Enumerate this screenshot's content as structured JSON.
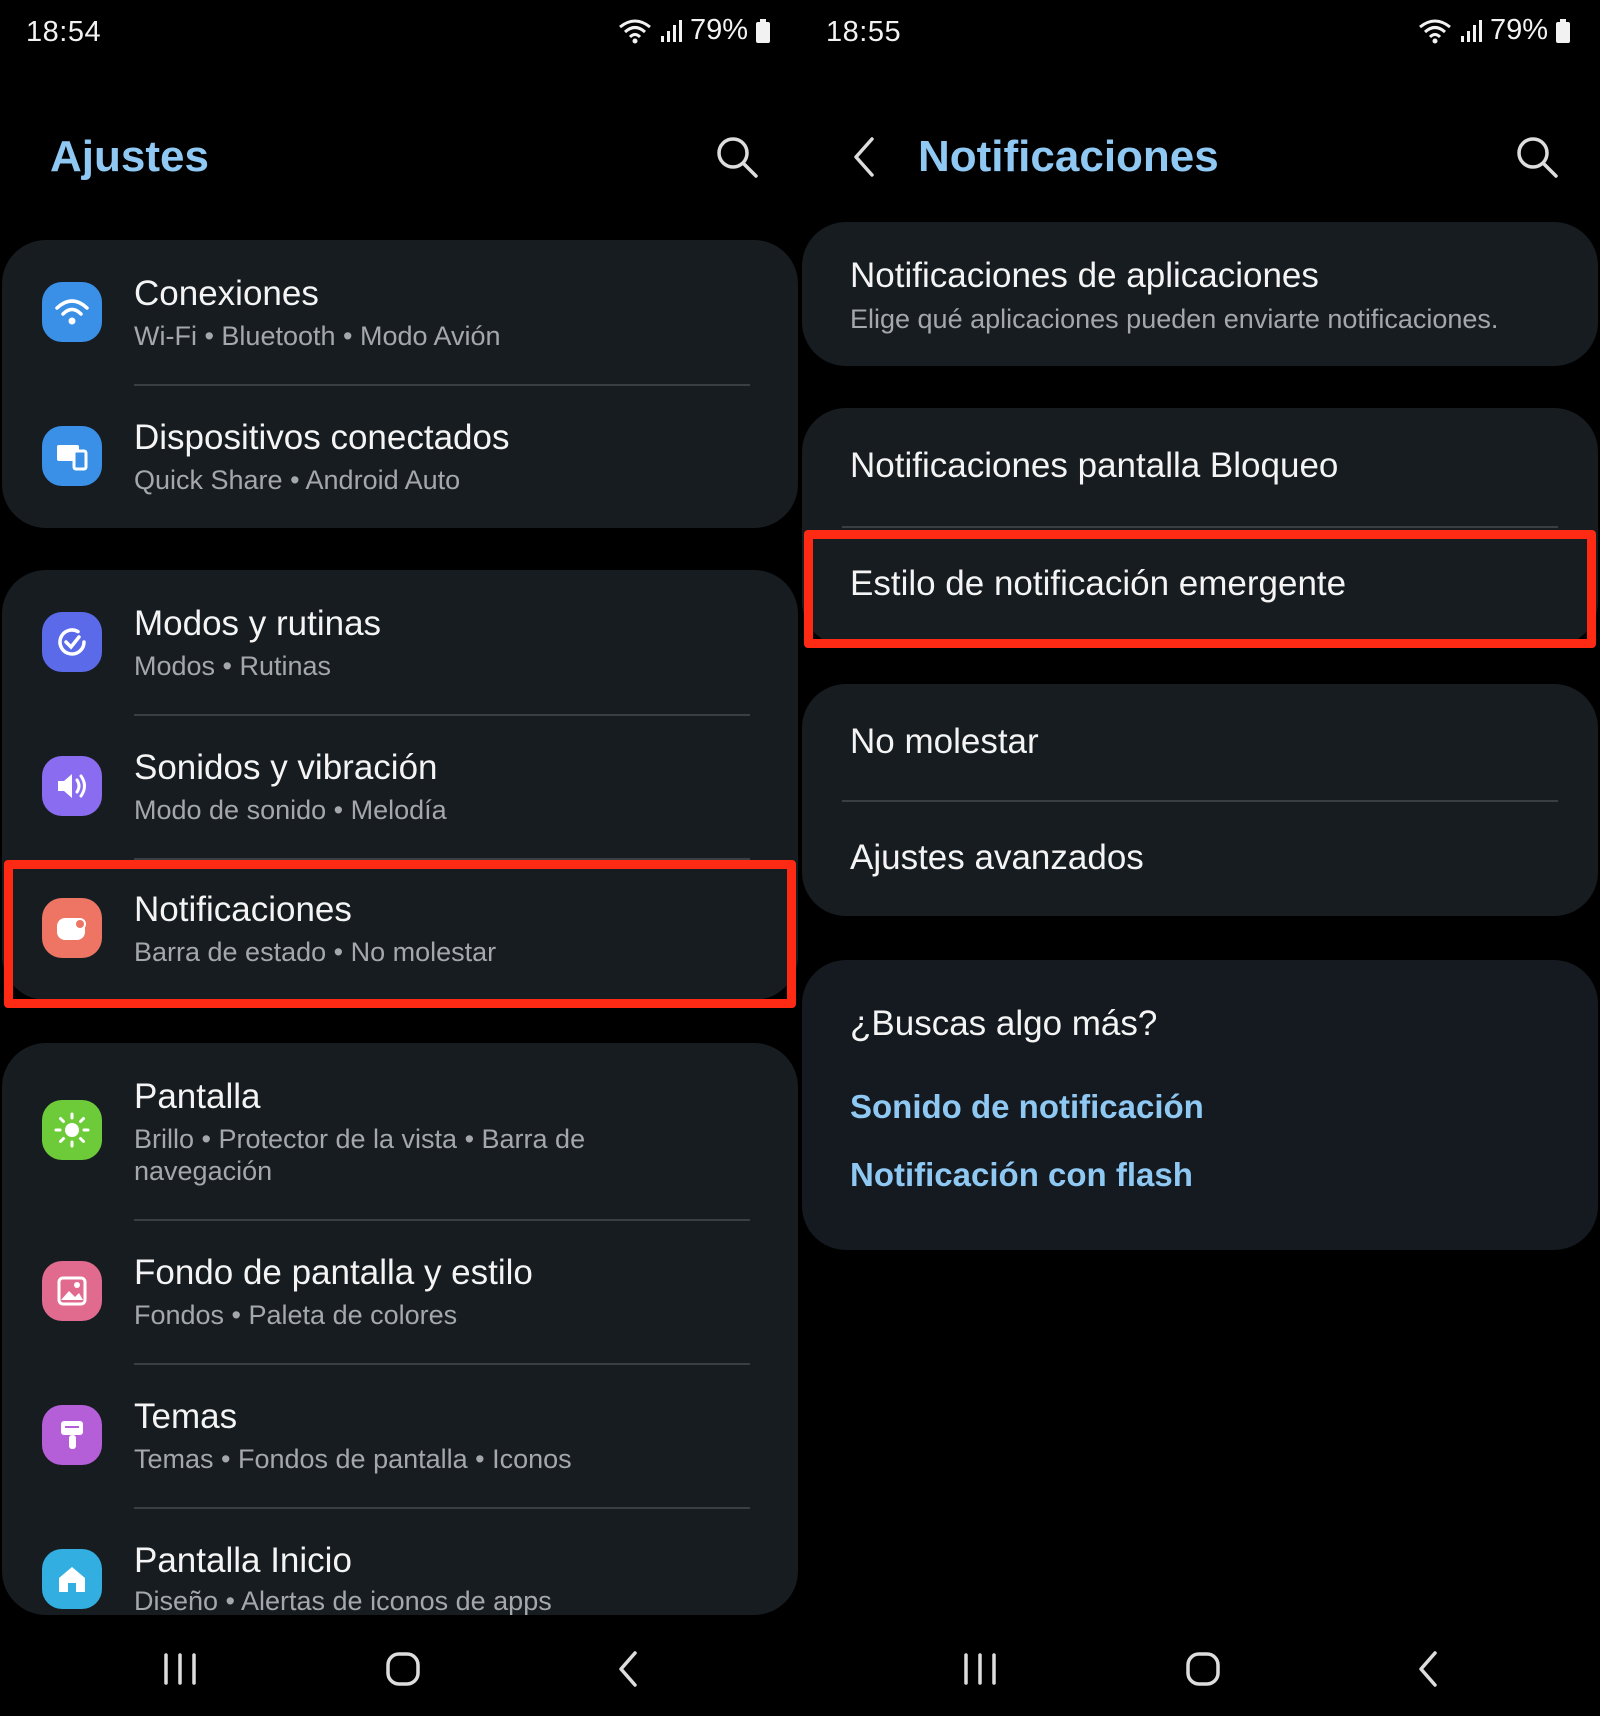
{
  "left": {
    "status": {
      "time": "18:54",
      "battery": "79%"
    },
    "header": {
      "title": "Ajustes"
    },
    "items": [
      {
        "title": "Conexiones",
        "subtitle": "Wi-Fi  •  Bluetooth  •  Modo Avión",
        "icon": "wifi-icon",
        "color": "#3a8fe6"
      },
      {
        "title": "Dispositivos conectados",
        "subtitle": "Quick Share  •  Android Auto",
        "icon": "devices-icon",
        "color": "#3a8fe6"
      },
      {
        "title": "Modos y rutinas",
        "subtitle": "Modos  •  Rutinas",
        "icon": "check-cycle-icon",
        "color": "#5a6ae8"
      },
      {
        "title": "Sonidos y vibración",
        "subtitle": "Modo de sonido  •  Melodía",
        "icon": "speaker-icon",
        "color": "#8a6cf0"
      },
      {
        "title": "Notificaciones",
        "subtitle": "Barra de estado  •  No molestar",
        "icon": "notification-icon",
        "color": "#ee7464"
      },
      {
        "title": "Pantalla",
        "subtitle": "Brillo  •  Protector de la vista  •  Barra de navegación",
        "icon": "brightness-icon",
        "color": "#6dcb3a"
      },
      {
        "title": "Fondo de pantalla y estilo",
        "subtitle": "Fondos  •  Paleta de colores",
        "icon": "wallpaper-icon",
        "color": "#e06b8e"
      },
      {
        "title": "Temas",
        "subtitle": "Temas  •  Fondos de pantalla  •  Iconos",
        "icon": "brush-icon",
        "color": "#b45ed8"
      },
      {
        "title": "Pantalla Inicio",
        "subtitle": "Diseño  •  Alertas de iconos de apps",
        "icon": "home-icon",
        "color": "#33aee0"
      }
    ]
  },
  "right": {
    "status": {
      "time": "18:55",
      "battery": "79%"
    },
    "header": {
      "title": "Notificaciones"
    },
    "app_notifications": {
      "title": "Notificaciones de aplicaciones",
      "subtitle": "Elige qué aplicaciones pueden enviarte notificaciones."
    },
    "lock_screen": {
      "title": "Notificaciones pantalla Bloqueo"
    },
    "popup_style": {
      "title": "Estilo de notificación emergente"
    },
    "dnd": {
      "title": "No molestar"
    },
    "advanced": {
      "title": "Ajustes avanzados"
    },
    "looking_for": {
      "title": "¿Buscas algo más?",
      "links": [
        "Sonido de notificación",
        "Notificación con flash"
      ]
    }
  },
  "colors": {
    "accent": "#8fc9f3",
    "card": "#171c20",
    "highlight": "#ff2a14"
  }
}
